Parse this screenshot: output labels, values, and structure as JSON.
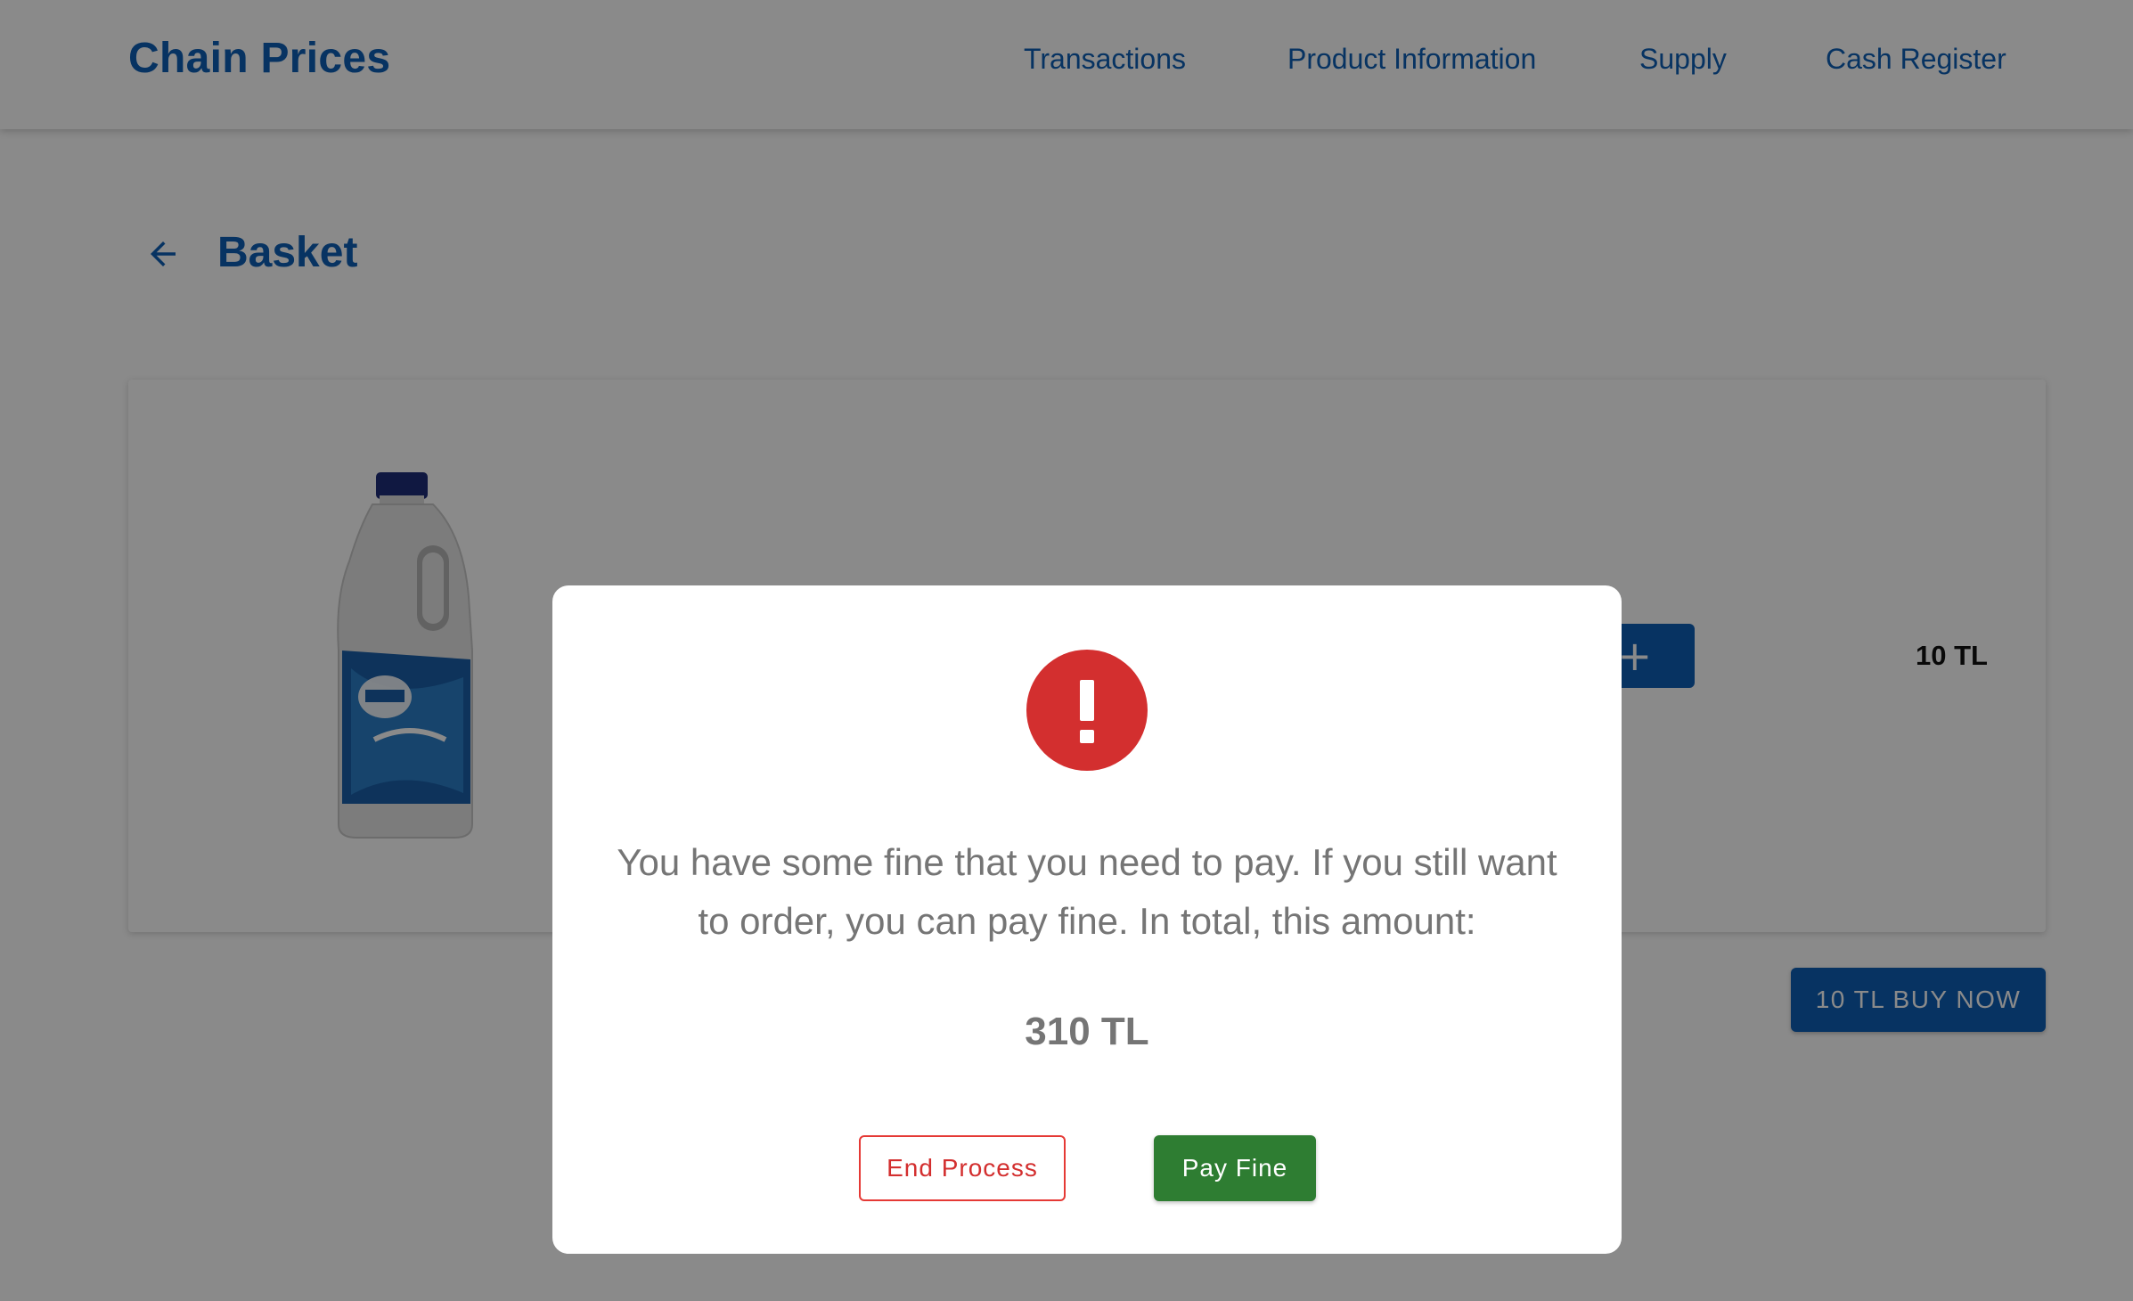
{
  "header": {
    "brand": "Chain Prices",
    "nav": [
      "Transactions",
      "Product Information",
      "Supply",
      "Cash Register"
    ]
  },
  "page": {
    "title": "Basket",
    "back_icon": "arrow-left-icon"
  },
  "basket": {
    "item": {
      "image": "ayran-bottle",
      "quantity_increase_icon": "plus-icon",
      "price": "10 TL"
    },
    "buy_now_label": "10 TL BUY NOW"
  },
  "modal": {
    "icon": "exclamation-icon",
    "message": "You have some fine that you need to pay. If you still want to order, you can pay fine. In total, this amount:",
    "amount": "310 TL",
    "end_label": "End Process",
    "pay_label": "Pay Fine"
  },
  "colors": {
    "brand": "#0d5fb5",
    "alert": "#d32f2f",
    "success": "#2e7d32"
  }
}
